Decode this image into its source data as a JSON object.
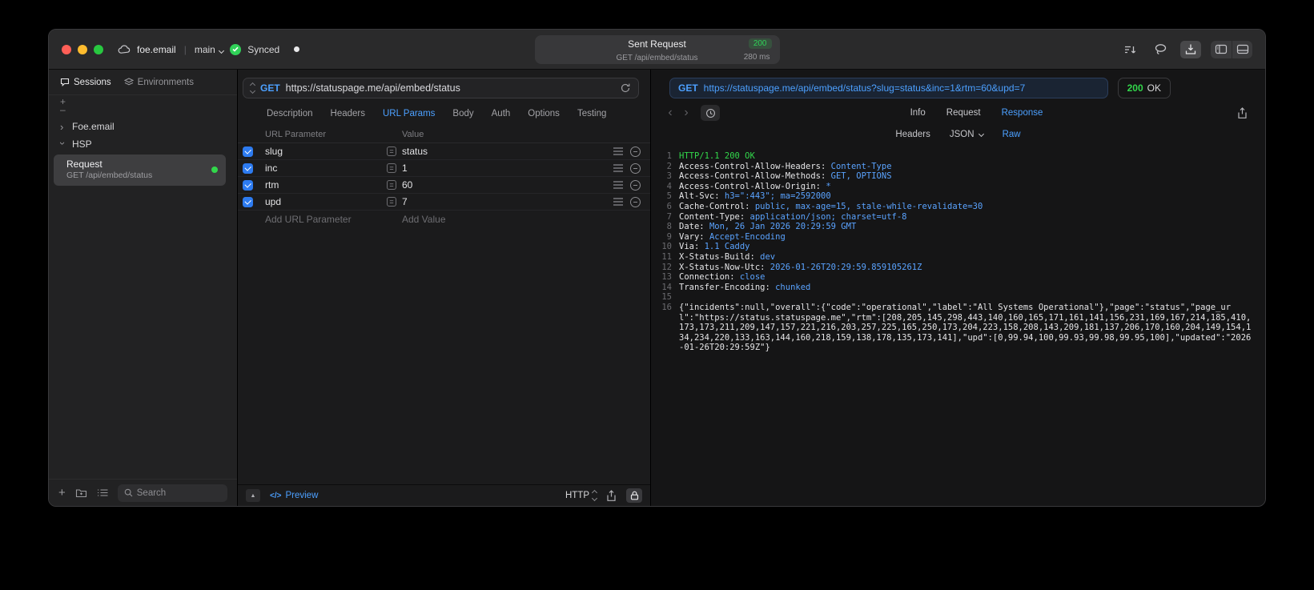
{
  "titlebar": {
    "project": "foe.email",
    "branch": "main",
    "sync": "Synced",
    "sent": {
      "title": "Sent Request",
      "status": "200",
      "subtitle": "GET /api/embed/status",
      "duration": "280 ms"
    }
  },
  "colors": {
    "accent_blue": "#4ca0ff",
    "success_green": "#32d74b",
    "checkbox_blue": "#2d7bf0"
  },
  "sidebar": {
    "tabs": [
      {
        "label": "Sessions"
      },
      {
        "label": "Environments"
      }
    ],
    "groups": [
      {
        "label": "Foe.email",
        "expanded": false
      },
      {
        "label": "HSP",
        "expanded": true
      }
    ],
    "request": {
      "title": "Request",
      "subtitle": "GET /api/embed/status"
    },
    "search_placeholder": "Search"
  },
  "request_panel": {
    "method": "GET",
    "url": "https://statuspage.me/api/embed/status",
    "tabs": [
      "Description",
      "Headers",
      "URL Params",
      "Body",
      "Auth",
      "Options",
      "Testing"
    ],
    "active_tab": "URL Params",
    "params": {
      "col_name": "URL Parameter",
      "col_value": "Value",
      "rows": [
        {
          "name": "slug",
          "value": "status",
          "enabled": true
        },
        {
          "name": "inc",
          "value": "1",
          "enabled": true
        },
        {
          "name": "rtm",
          "value": "60",
          "enabled": true
        },
        {
          "name": "upd",
          "value": "7",
          "enabled": true
        }
      ],
      "add_name": "Add URL Parameter",
      "add_value": "Add Value"
    },
    "footer": {
      "preview": "Preview",
      "code_icon": "</>",
      "protocol": "HTTP"
    }
  },
  "response_panel": {
    "request_line": {
      "method": "GET",
      "url": "https://statuspage.me/api/embed/status?slug=status&inc=1&rtm=60&upd=7"
    },
    "status_code": "200",
    "status_text": "OK",
    "tabs": [
      "Info",
      "Request",
      "Response"
    ],
    "active_tab": "Response",
    "subtabs": [
      "Headers",
      "JSON",
      "Raw"
    ],
    "active_subtab": "Raw",
    "status_line": "HTTP/1.1 200 OK",
    "headers": [
      {
        "name": "Access-Control-Allow-Headers",
        "value": "Content-Type"
      },
      {
        "name": "Access-Control-Allow-Methods",
        "value": "GET, OPTIONS"
      },
      {
        "name": "Access-Control-Allow-Origin",
        "value": "*"
      },
      {
        "name": "Alt-Svc",
        "value": "h3=\":443\"; ma=2592000"
      },
      {
        "name": "Cache-Control",
        "value": "public, max-age=15, stale-while-revalidate=30"
      },
      {
        "name": "Content-Type",
        "value": "application/json; charset=utf-8"
      },
      {
        "name": "Date",
        "value": "Mon, 26 Jan 2026 20:29:59 GMT"
      },
      {
        "name": "Vary",
        "value": "Accept-Encoding"
      },
      {
        "name": "Via",
        "value": "1.1 Caddy"
      },
      {
        "name": "X-Status-Build",
        "value": "dev"
      },
      {
        "name": "X-Status-Now-Utc",
        "value": "2026-01-26T20:29:59.859105261Z"
      },
      {
        "name": "Connection",
        "value": "close"
      },
      {
        "name": "Transfer-Encoding",
        "value": "chunked"
      }
    ],
    "body": "{\"incidents\":null,\"overall\":{\"code\":\"operational\",\"label\":\"All Systems Operational\"},\"page\":\"status\",\"page_url\":\"https://status.statuspage.me\",\"rtm\":[208,205,145,298,443,140,160,165,171,161,141,156,231,169,167,214,185,410,173,173,211,209,147,157,221,216,203,257,225,165,250,173,204,223,158,208,143,209,181,137,206,170,160,204,149,154,134,234,220,133,163,144,160,218,159,138,178,135,173,141],\"upd\":[0,99.94,100,99.93,99.98,99.95,100],\"updated\":\"2026-01-26T20:29:59Z\"}"
  }
}
